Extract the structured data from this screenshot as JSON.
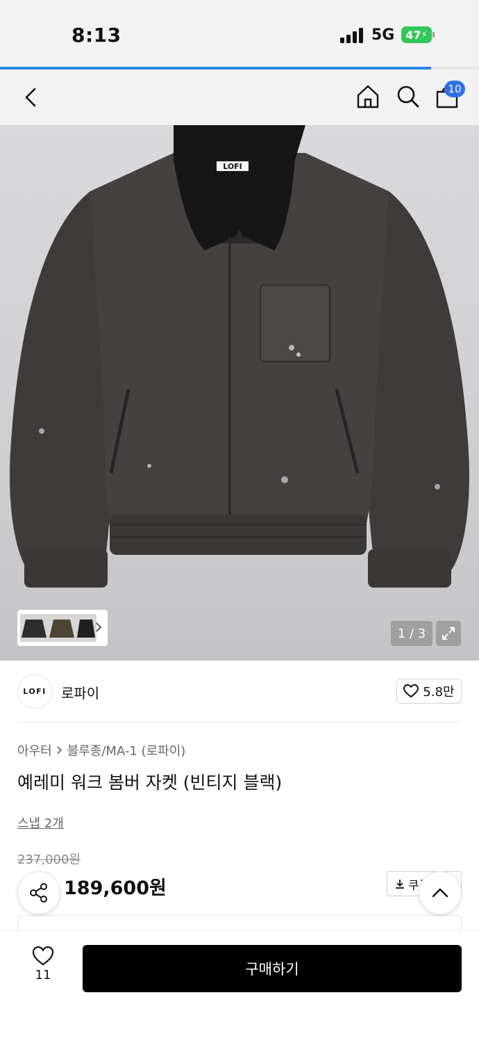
{
  "status_bar": {
    "time": "8:13",
    "network": "5G",
    "battery": "47"
  },
  "page_progress": 0.9,
  "header": {
    "back_icon": "chevron-left-icon",
    "home_icon": "home-icon",
    "search_icon": "search-icon",
    "cart_icon": "shopping-bag-icon",
    "cart_badge": "10"
  },
  "gallery": {
    "counter": "1 / 3",
    "current": 1,
    "total": 3,
    "expand_icon": "expand-icon",
    "logo_label": "LOFI"
  },
  "brand": {
    "logo_text": "LOFI",
    "name": "로파이",
    "likes": "5.8만"
  },
  "product": {
    "breadcrumb": [
      "아우터",
      "블루종/MA-1 (로파이)"
    ],
    "title": "예레미 워크 봄버 자켓 (빈티지 블랙)",
    "snap": "스냅 2개",
    "original_price": "237,000원",
    "sale_price": "189,600원",
    "coupon_label": "쿠폰"
  },
  "bottom_bar": {
    "wish_count": "11",
    "buy_label": "구매하기"
  },
  "colors": {
    "accent_blue": "#2f6fe8",
    "sale_red": "#e5352b",
    "buy_button": "#000000"
  }
}
